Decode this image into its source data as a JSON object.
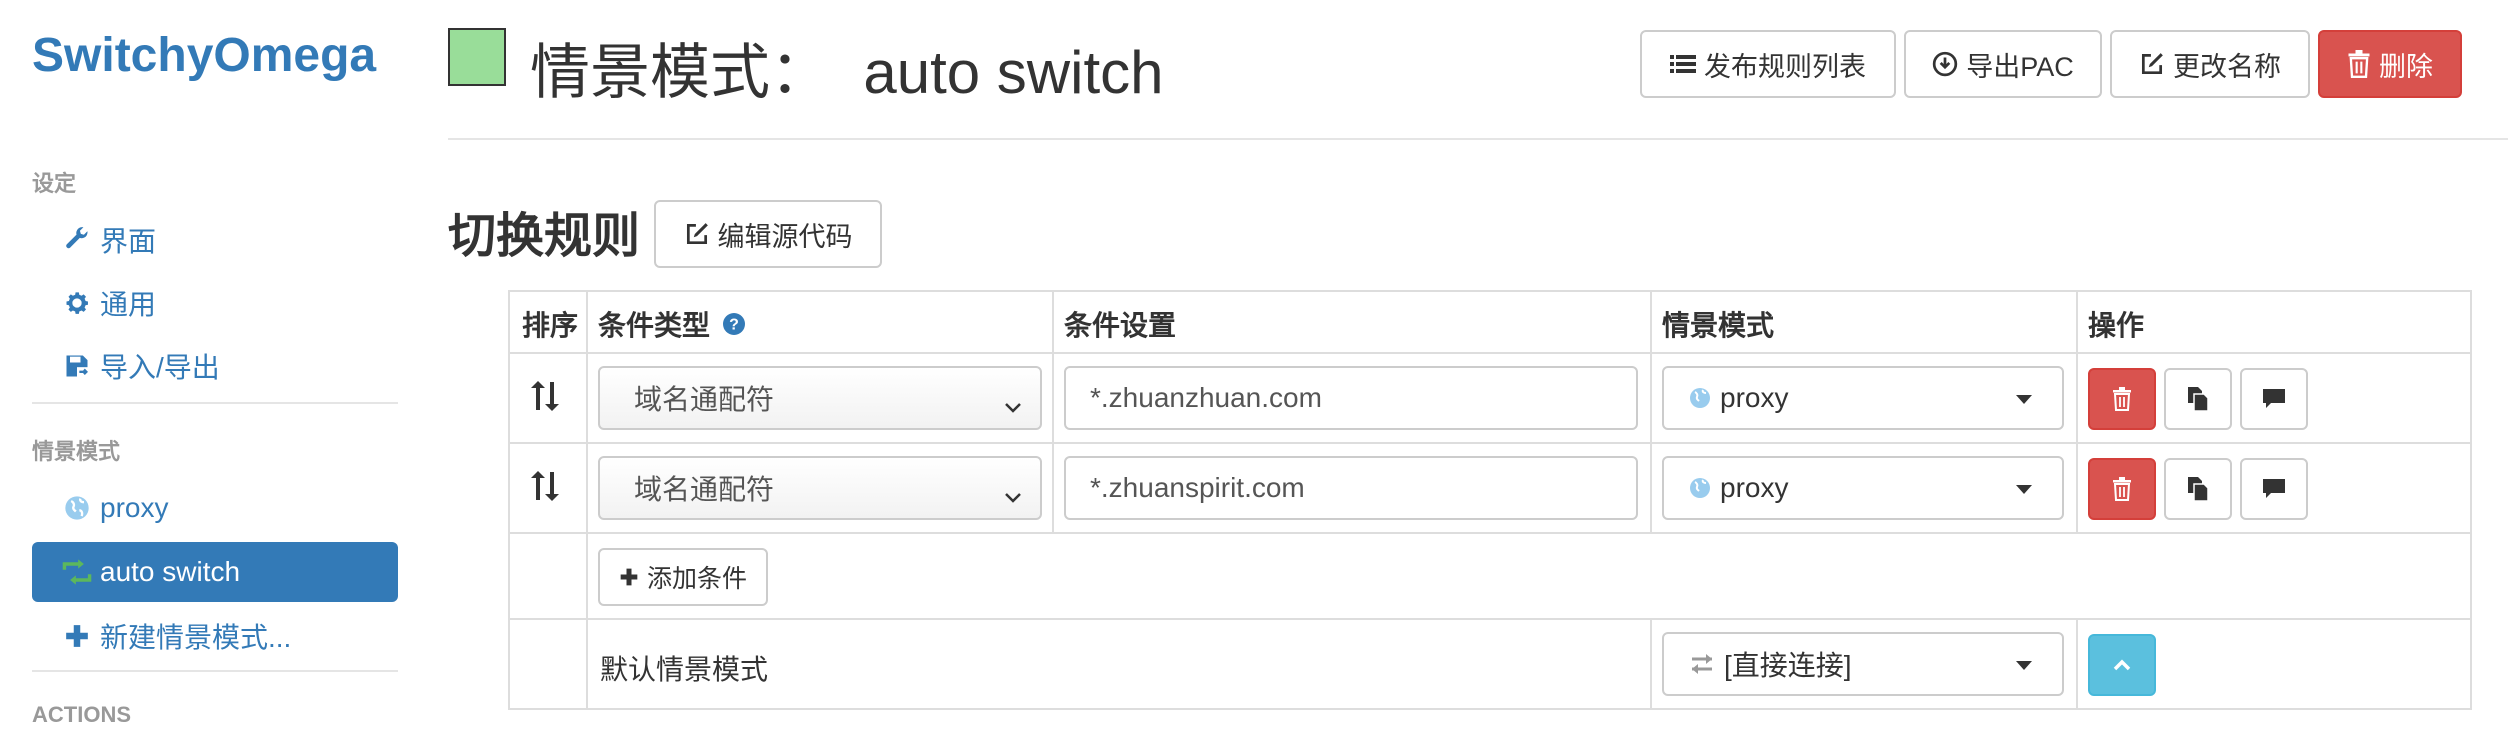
{
  "app": {
    "brand": "SwitchyOmega"
  },
  "sidebar": {
    "settings_header": "设定",
    "settings_items": [
      {
        "label": "界面",
        "icon": "wrench-icon"
      },
      {
        "label": "通用",
        "icon": "gear-icon"
      },
      {
        "label": "导入/导出",
        "icon": "floppy-icon"
      }
    ],
    "profiles_header": "情景模式",
    "profiles": [
      {
        "label": "proxy",
        "icon": "globe-icon",
        "active": false
      },
      {
        "label": "auto switch",
        "icon": "retweet-icon",
        "active": true
      }
    ],
    "new_profile": "新建情景模式...",
    "actions_header": "ACTIONS"
  },
  "header": {
    "title": "情景模式：  auto switch",
    "swatch_color": "#99dd99",
    "buttons": {
      "publish": "发布规则列表",
      "export_pac": "导出PAC",
      "rename": "更改名称",
      "delete": "删除"
    }
  },
  "section": {
    "title": "切换规则",
    "edit_source": "编辑源代码"
  },
  "table": {
    "headers": {
      "order": "排序",
      "condition_type": "条件类型",
      "condition": "条件设置",
      "profile": "情景模式",
      "actions": "操作"
    },
    "rows": [
      {
        "condition_type": "域名通配符",
        "condition": "*.zhuanzhuan.com",
        "profile": "proxy"
      },
      {
        "condition_type": "域名通配符",
        "condition": "*.zhuanspirit.com",
        "profile": "proxy"
      }
    ],
    "add_condition": "添加条件",
    "default_label": "默认情景模式",
    "default_profile": "[直接连接]"
  },
  "colors": {
    "primary": "#337ab7",
    "danger": "#d9534f",
    "info": "#5bc0de",
    "green_icon": "#5cb85c"
  }
}
